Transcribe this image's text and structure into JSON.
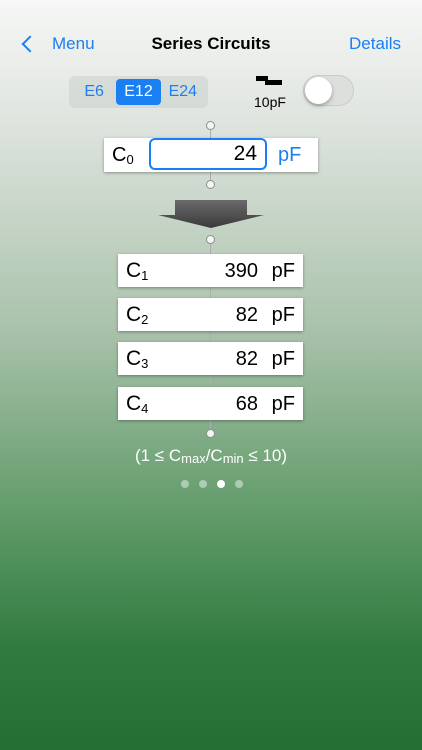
{
  "nav": {
    "back_label": "Menu",
    "title": "Series Circuits",
    "details_label": "Details"
  },
  "series_selector": {
    "options": [
      "E6",
      "E12",
      "E24"
    ],
    "selected": "E12"
  },
  "stray_capacitance": {
    "label": "10pF",
    "enabled": false
  },
  "input": {
    "symbol": "C",
    "subscript": "0",
    "value": "24",
    "unit": "pF"
  },
  "results": [
    {
      "symbol": "C",
      "subscript": "1",
      "value": "390",
      "unit": "pF"
    },
    {
      "symbol": "C",
      "subscript": "2",
      "value": "82",
      "unit": "pF"
    },
    {
      "symbol": "C",
      "subscript": "3",
      "value": "82",
      "unit": "pF"
    },
    {
      "symbol": "C",
      "subscript": "4",
      "value": "68",
      "unit": "pF"
    }
  ],
  "ratio": {
    "open": "(1 ≤ C",
    "max": "max",
    "slash": "/C",
    "min": "min",
    "close": " ≤ 10)"
  },
  "pager": {
    "count": 4,
    "current": 3
  }
}
